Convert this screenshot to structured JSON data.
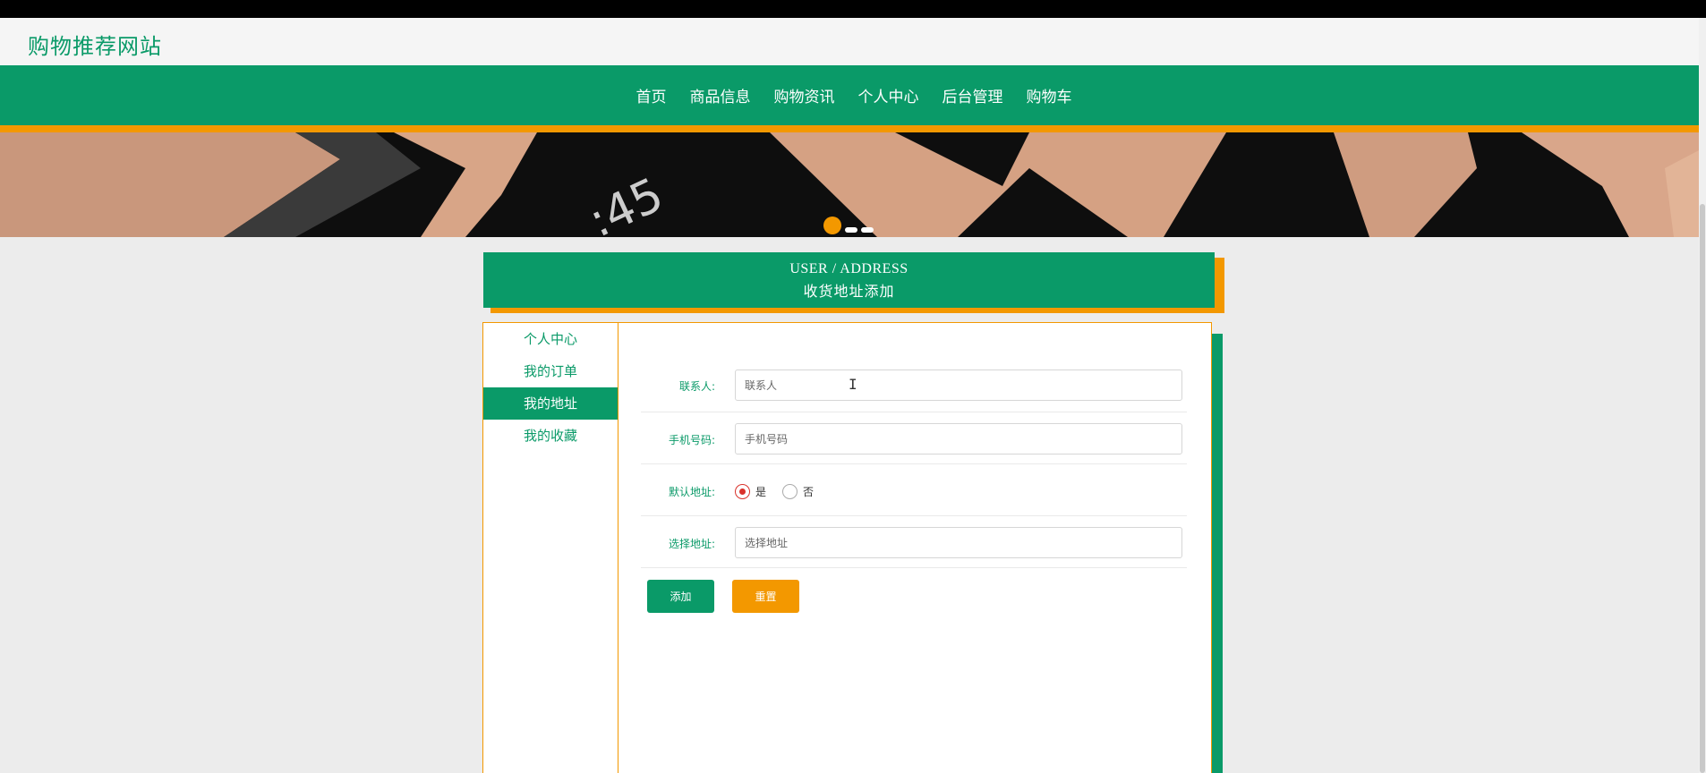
{
  "site": {
    "title": "购物推荐网站"
  },
  "nav": {
    "items": [
      "首页",
      "商品信息",
      "购物资讯",
      "个人中心",
      "后台管理",
      "购物车"
    ]
  },
  "page": {
    "title_en": "USER / ADDRESS",
    "title_cn": "收货地址添加"
  },
  "sidebar": {
    "items": [
      "个人中心",
      "我的订单",
      "我的地址",
      "我的收藏"
    ],
    "active": "我的地址"
  },
  "form": {
    "contact_label": "联系人:",
    "contact_placeholder": "联系人",
    "phone_label": "手机号码:",
    "phone_placeholder": "手机号码",
    "default_label": "默认地址:",
    "default_yes": "是",
    "default_no": "否",
    "default_selected": "是",
    "address_label": "选择地址:",
    "address_placeholder": "选择地址",
    "add_label": "添加",
    "reset_label": "重置"
  },
  "colors": {
    "primary": "#0a9a68",
    "accent": "#f39800",
    "radio_active": "#d9322b"
  }
}
